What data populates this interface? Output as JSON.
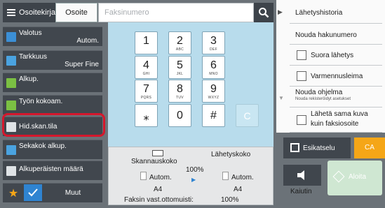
{
  "tabs": {
    "address_book": "Osoitekirja",
    "address": "Osoite"
  },
  "fax_input": {
    "placeholder": "Faksinumero"
  },
  "left_menu": {
    "exposure": {
      "label": "Valotus",
      "value": "Autom."
    },
    "resolution": {
      "label": "Tarkkuus",
      "value": "Super Fine"
    },
    "original": {
      "label": "Alkup."
    },
    "job_build": {
      "label": "Työn kokoam."
    },
    "slow_scan": {
      "label": "Hid.skan.tila"
    },
    "mixed_original": {
      "label": "Sekakok alkup."
    },
    "original_count": {
      "label": "Alkuperäisten määrä"
    },
    "more": {
      "label": "Muut"
    }
  },
  "keypad": {
    "keys": [
      {
        "digit": "1",
        "sub": ""
      },
      {
        "digit": "2",
        "sub": "ABC"
      },
      {
        "digit": "3",
        "sub": "DEF"
      },
      {
        "digit": "4",
        "sub": "GHI"
      },
      {
        "digit": "5",
        "sub": "JKL"
      },
      {
        "digit": "6",
        "sub": "MNO"
      },
      {
        "digit": "7",
        "sub": "PQRS"
      },
      {
        "digit": "8",
        "sub": "TUV"
      },
      {
        "digit": "9",
        "sub": "WXYZ"
      },
      {
        "digit": "⁎",
        "sub": ""
      },
      {
        "digit": "0",
        "sub": ""
      },
      {
        "digit": "#",
        "sub": ""
      }
    ],
    "clear": "C"
  },
  "bottom_panel": {
    "scan_size_label": "Skannauskoko",
    "send_size_label": "Lähetyskoko",
    "ratio": "100%",
    "scan_size_mode": "Autom.",
    "scan_size_value": "A4",
    "send_size_mode": "Autom.",
    "send_size_value": "A4",
    "memory_label": "Faksin vast.ottomuisti:",
    "memory_value": "100%"
  },
  "right_menu": {
    "history": "Lähetyshistoria",
    "recall": "Nouda hakunumero",
    "direct_tx": "Suora lähetys",
    "verification_stamp": "Varmennusleima",
    "call_program": "Nouda ohjelma",
    "call_program_sub": "Nouda rekisteröidyt asetukset",
    "send_same_image": "Lähetä sama kuva kuin faksiosoite"
  },
  "actions": {
    "preview": "Esikatselu",
    "ca": "CA",
    "speaker": "Kaiutin",
    "start": "Aloita"
  },
  "colors": {
    "highlight": "#d5172c",
    "ca": "#f5a617",
    "keypad_bg": "#b8dcec"
  }
}
